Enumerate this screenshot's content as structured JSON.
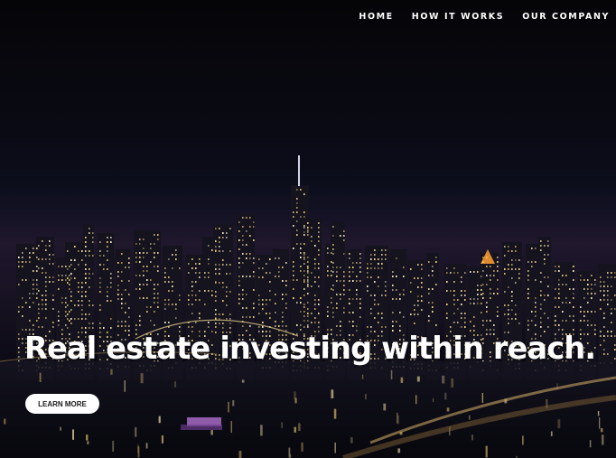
{
  "nav": {
    "items": [
      {
        "label": "HOME"
      },
      {
        "label": "HOW IT WORKS"
      },
      {
        "label": "OUR COMPANY"
      }
    ]
  },
  "hero": {
    "headline": "Real estate investing within reach.",
    "cta_label": "LEARN MORE",
    "background": "night-city-skyline-image"
  },
  "colors": {
    "text": "#ffffff",
    "button_bg": "#ffffff",
    "button_text": "#1a1a1a",
    "sky": "#06060c"
  }
}
